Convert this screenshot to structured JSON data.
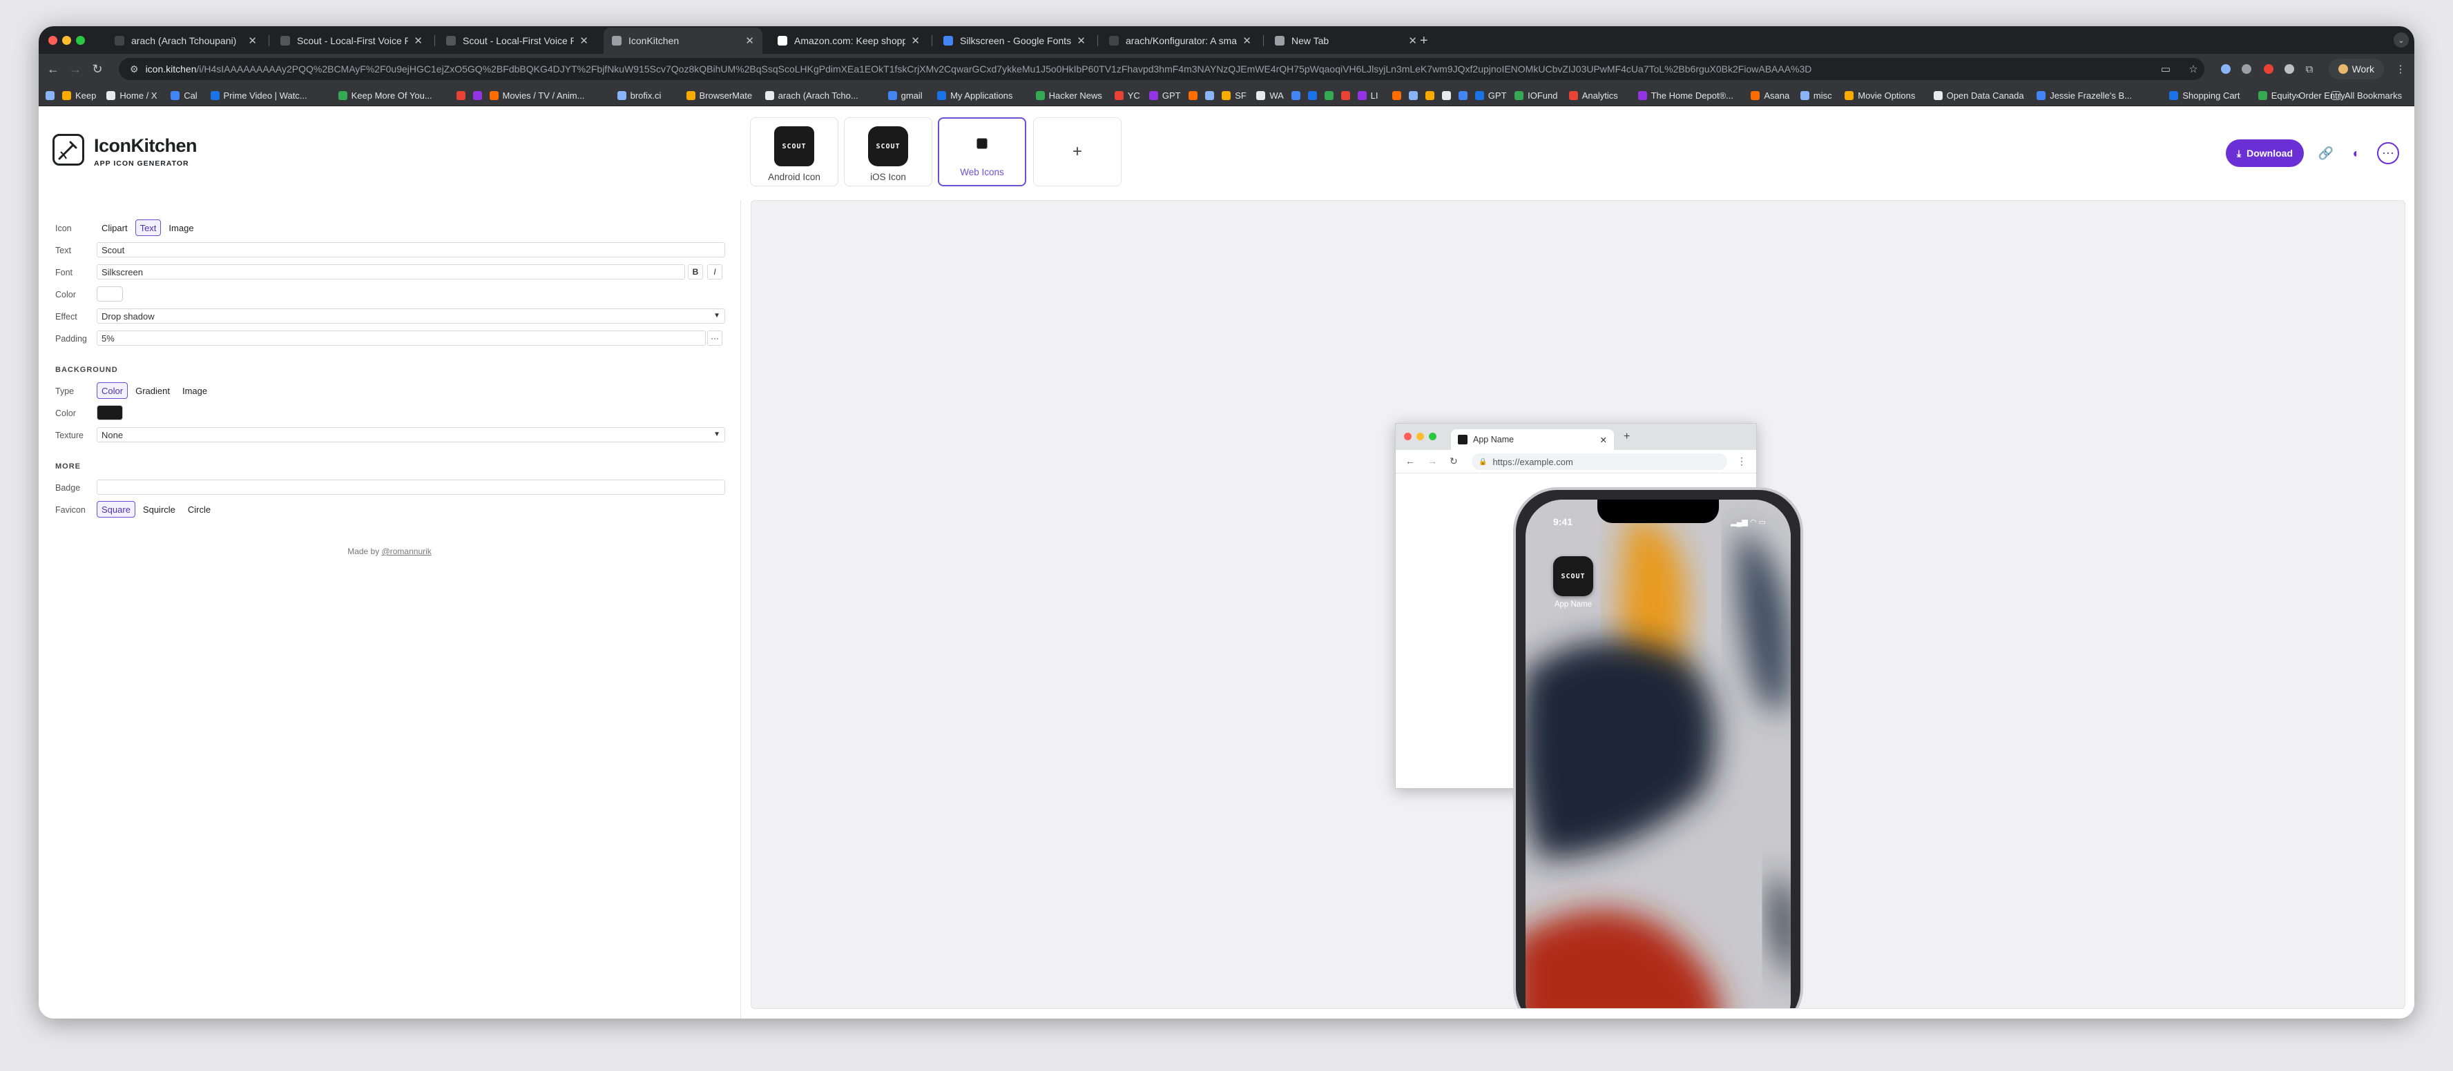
{
  "browser": {
    "tabs": [
      {
        "title": "arach (Arach Tchoupani)",
        "favicon": "github-icon",
        "active": false
      },
      {
        "title": "Scout - Local-First Voice Re",
        "favicon": "scout-icon",
        "active": false
      },
      {
        "title": "Scout - Local-First Voice Re",
        "favicon": "scout-icon",
        "active": false
      },
      {
        "title": "IconKitchen",
        "favicon": "iconkitchen-icon",
        "active": true
      },
      {
        "title": "Amazon.com: Keep shopping",
        "favicon": "amazon-icon",
        "active": false
      },
      {
        "title": "Silkscreen - Google Fonts",
        "favicon": "google-fonts-icon",
        "active": false
      },
      {
        "title": "arach/Konfigurator: A small u",
        "favicon": "github-icon",
        "active": false
      },
      {
        "title": "New Tab",
        "favicon": "chrome-icon",
        "active": false
      }
    ],
    "url_host": "icon.kitchen",
    "url_path": "/i/H4sIAAAAAAAAAy2PQQ%2BCMAyF%2F0u9ejHGC1ejZxO5GQ%2BFdbBQKG4DJYT%2FbjfNkuW915Scv7Qoz8kQBihUM%2BqSsqScoLHKgPdimXEa1EOkT1fskCrjXMv2CqwarGCxd7ykkeMu1J5o0HkIbP60TV1zFhavpd3hmF4m3NAYNzQJEmWE4rQH75pWqaoqiVH6LJlsyjLn3mLeK7wm9JQxf2upjnoIENOMkUCbvZIJ03UPwMF4cUa7ToL%2Bb6rguX0Bk2FiowABAAA%3D",
    "profile_label": "Work",
    "bookmarks": [
      {
        "label": "",
        "icon": "apps-icon"
      },
      {
        "label": "Keep",
        "icon": "keep-icon"
      },
      {
        "label": "Home / X",
        "icon": "x-icon"
      },
      {
        "label": "Cal",
        "icon": "calendar-icon"
      },
      {
        "label": "Prime Video | Watc...",
        "icon": "prime-icon"
      },
      {
        "label": "Keep More Of You...",
        "icon": "leaf-icon"
      },
      {
        "label": "",
        "icon": "app-icon"
      },
      {
        "label": "",
        "icon": "app-icon"
      },
      {
        "label": "Movies / TV / Anim...",
        "icon": "play-icon"
      },
      {
        "label": "brofix.ci",
        "icon": "app-icon"
      },
      {
        "label": "BrowserMate",
        "icon": "app-icon"
      },
      {
        "label": "arach (Arach Tcho...",
        "icon": "github-icon"
      },
      {
        "label": "gmail",
        "icon": "mail-icon"
      },
      {
        "label": "My Applications",
        "icon": "y-icon"
      },
      {
        "label": "Hacker News",
        "icon": "y-icon"
      },
      {
        "label": "YC",
        "icon": "y-icon"
      },
      {
        "label": "GPT",
        "icon": "gpt-icon"
      },
      {
        "label": "",
        "icon": "app-icon"
      },
      {
        "label": "",
        "icon": "app-icon"
      },
      {
        "label": "SF",
        "icon": "app-icon"
      },
      {
        "label": "WA",
        "icon": "whatsapp-icon"
      },
      {
        "label": "",
        "icon": "app-icon"
      },
      {
        "label": "",
        "icon": "app-icon"
      },
      {
        "label": "",
        "icon": "app-icon"
      },
      {
        "label": "",
        "icon": "app-icon"
      },
      {
        "label": "LI",
        "icon": "linkedin-icon"
      },
      {
        "label": "",
        "icon": "app-icon"
      },
      {
        "label": "",
        "icon": "app-icon"
      },
      {
        "label": "",
        "icon": "app-icon"
      },
      {
        "label": "",
        "icon": "app-icon"
      },
      {
        "label": "",
        "icon": "app-icon"
      },
      {
        "label": "GPT",
        "icon": "gpt-icon"
      },
      {
        "label": "IOFund",
        "icon": "app-icon"
      },
      {
        "label": "Analytics",
        "icon": "analytics-icon"
      },
      {
        "label": "The Home Depot®...",
        "icon": "app-icon"
      },
      {
        "label": "Asana",
        "icon": "asana-icon"
      },
      {
        "label": "misc",
        "icon": "folder-icon"
      },
      {
        "label": "Movie Options",
        "icon": "folder-icon"
      },
      {
        "label": "Open Data Canada",
        "icon": "folder-icon"
      },
      {
        "label": "Jessie Frazelle's B...",
        "icon": "app-icon"
      },
      {
        "label": "Shopping Cart",
        "icon": "app-icon"
      },
      {
        "label": "Equity Order Entry",
        "icon": "app-icon"
      }
    ],
    "all_bookmarks": "All Bookmarks"
  },
  "app": {
    "brand": "IconKitchen",
    "brand_sub": "APP ICON GENERATOR",
    "targets": [
      {
        "label": "Android Icon",
        "preview": "SCOUT",
        "selected": false
      },
      {
        "label": "iOS Icon",
        "preview": "SCOUT",
        "selected": false
      },
      {
        "label": "Web Icons",
        "preview": "",
        "selected": true
      },
      {
        "label": "+",
        "preview": "",
        "selected": false
      }
    ],
    "download_label": "Download",
    "accent_color": "#6b2fd6"
  },
  "form": {
    "icon": {
      "label": "Icon",
      "options": [
        "Clipart",
        "Text",
        "Image"
      ],
      "selected": "Text"
    },
    "text": {
      "label": "Text",
      "value": "Scout"
    },
    "font": {
      "label": "Font",
      "value": "Silkscreen",
      "bold": "B",
      "italic": "I"
    },
    "color": {
      "label": "Color",
      "value": "#ffffff"
    },
    "effect": {
      "label": "Effect",
      "value": "Drop shadow"
    },
    "padding": {
      "label": "Padding",
      "value": "5%",
      "more": "···"
    },
    "background": {
      "heading": "BACKGROUND",
      "type": {
        "label": "Type",
        "options": [
          "Color",
          "Gradient",
          "Image"
        ],
        "selected": "Color"
      },
      "color": {
        "label": "Color",
        "value": "#1a1a1a"
      },
      "texture": {
        "label": "Texture",
        "value": "None"
      }
    },
    "more": {
      "heading": "MORE",
      "badge": {
        "label": "Badge",
        "value": ""
      },
      "favicon": {
        "label": "Favicon",
        "options": [
          "Square",
          "Squircle",
          "Circle"
        ],
        "selected": "Square"
      }
    },
    "made_by_prefix": "Made by",
    "made_by_link": "@romannurik"
  },
  "preview": {
    "browser_tab_title": "App Name",
    "browser_url": "https://example.com",
    "phone_time": "9:41",
    "app_icon_text": "SCOUT",
    "app_name": "App Name"
  }
}
